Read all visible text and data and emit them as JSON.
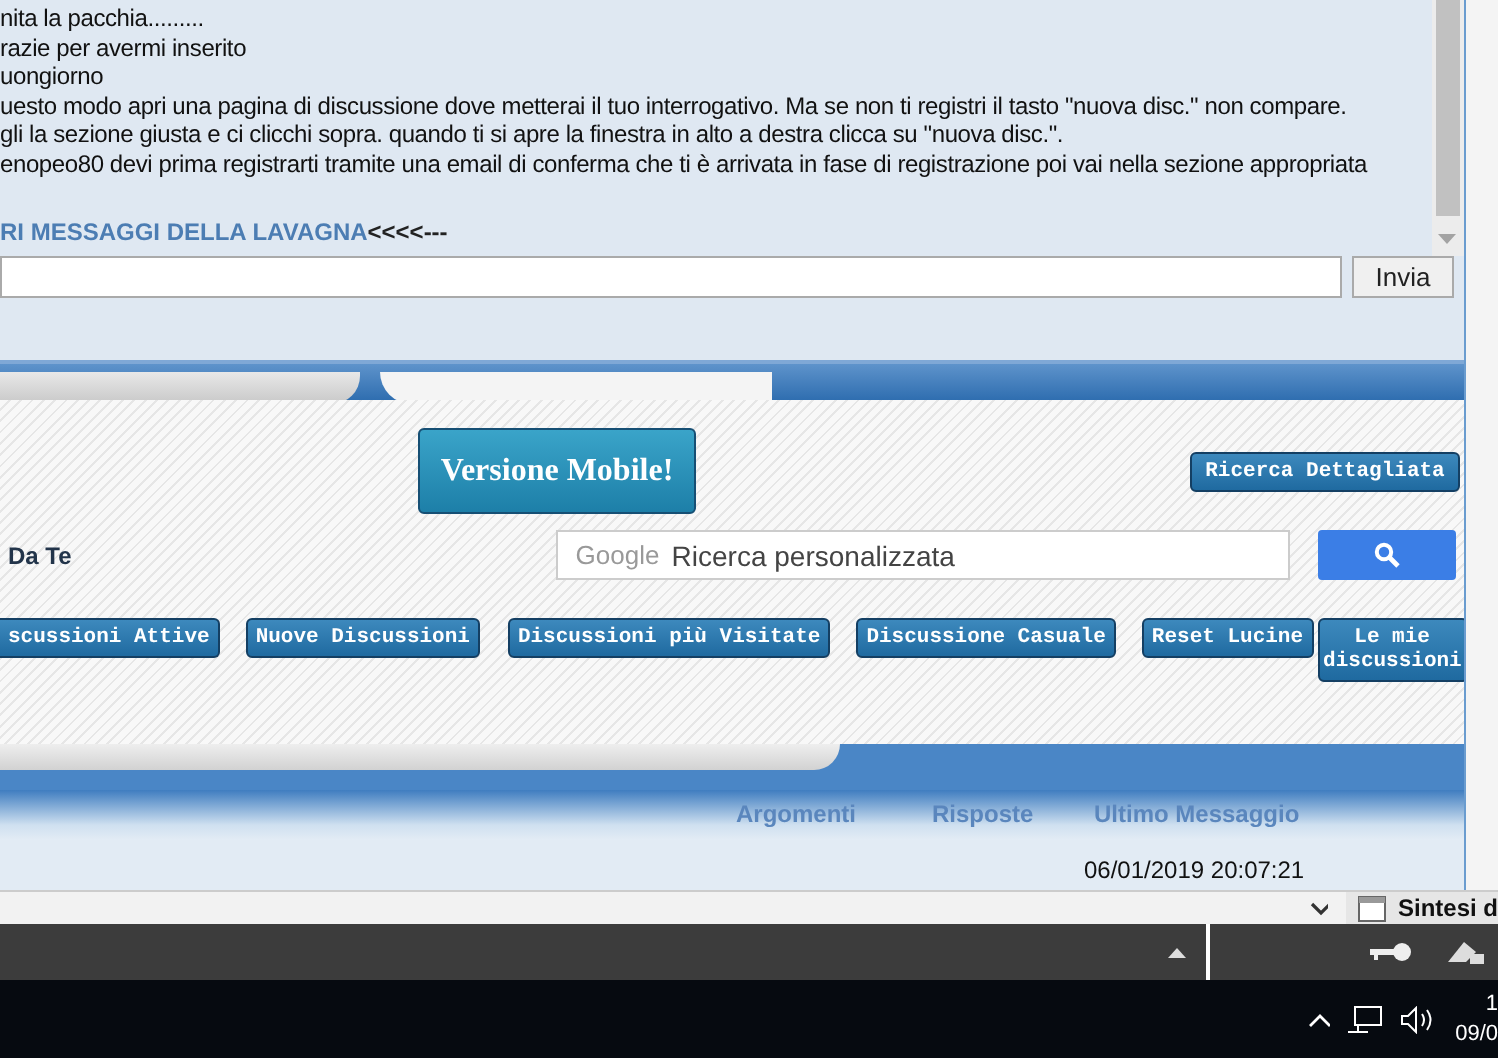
{
  "chat": {
    "messages": [
      "nita la pacchia.........",
      "razie per avermi inserito",
      "uongiorno",
      "uesto modo apri una pagina di discussione dove metterai il tuo interrogativo. Ma se non ti registri il tasto \"nuova disc.\" non compare.",
      "gli la sezione giusta e ci clicchi sopra. quando ti si apre la finestra in alto a destra clicca su \"nuova disc.\".",
      "enopeo80 devi prima registrarti tramite una email di conferma che ti è arrivata in fase di registrazione poi vai nella sezione appropriata"
    ],
    "link": "RI MESSAGGI DELLA LAVAGNA",
    "link_suffix": "<<<<---",
    "send": "Invia"
  },
  "mobile_button": "Versione Mobile!",
  "advanced_search": "Ricerca Dettagliata",
  "greeting": "Da Te",
  "search": {
    "brand": "Google",
    "placeholder": "Ricerca personalizzata"
  },
  "nav": [
    "scussioni Attive",
    "Nuove Discussioni",
    "Discussioni più Visitate",
    "Discussione Casuale",
    "Reset Lucine",
    "Le mie discussioni"
  ],
  "forum_table": {
    "columns": [
      "Argomenti",
      "Risposte",
      "Ultimo Messaggio"
    ],
    "last_post_date": "06/01/2019 20:07:21"
  },
  "browser_tab": "Sintesi d",
  "taskbar": {
    "clock_time": "1",
    "clock_date": "09/0"
  }
}
